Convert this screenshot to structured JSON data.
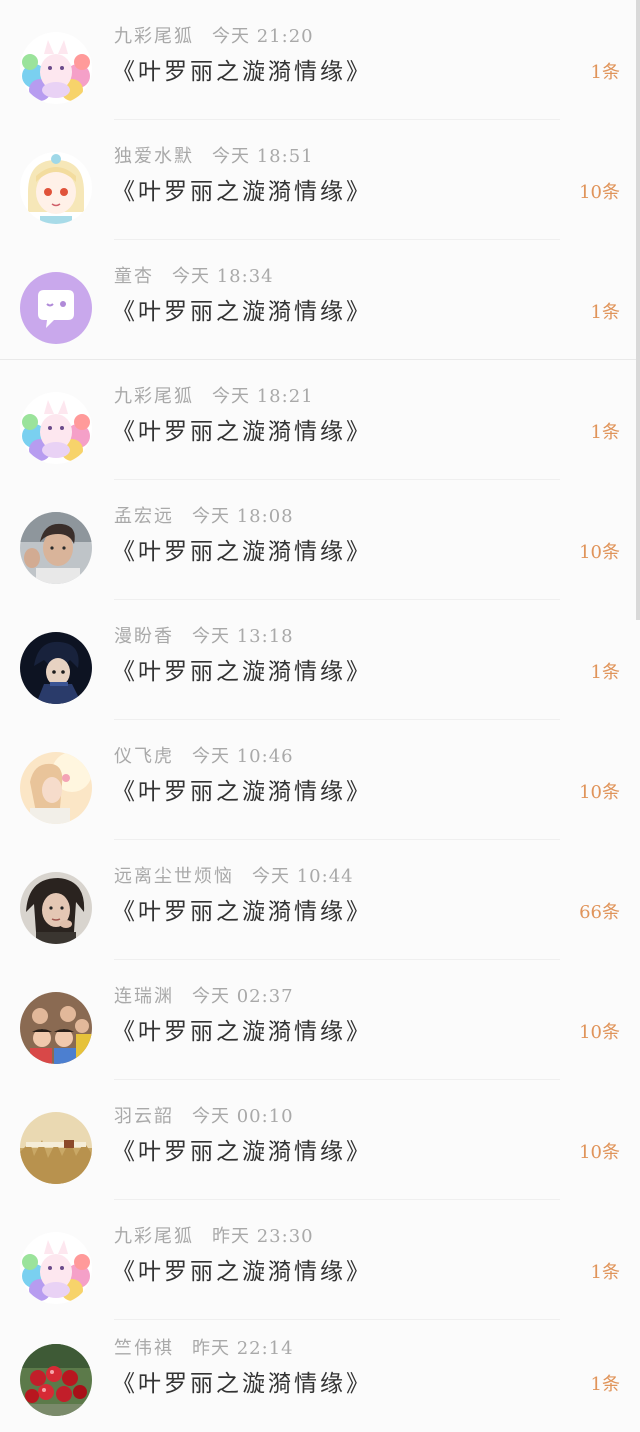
{
  "feed": {
    "accent_color": "#e0945a",
    "items": [
      {
        "user": "九彩尾狐",
        "time": "今天 21:20",
        "title": "《叶罗丽之漩漪情缘》",
        "count": "1条",
        "avatar_icon": "fox-avatar-icon"
      },
      {
        "user": "独爱水默",
        "time": "今天 18:51",
        "title": "《叶罗丽之漩漪情缘》",
        "count": "10条",
        "avatar_icon": "anime-girl-avatar-icon"
      },
      {
        "user": "童杏",
        "time": "今天 18:34",
        "title": "《叶罗丽之漩漪情缘》",
        "count": "1条",
        "avatar_icon": "chat-bubble-avatar-icon"
      },
      {
        "user": "九彩尾狐",
        "time": "今天 18:21",
        "title": "《叶罗丽之漩漪情缘》",
        "count": "1条",
        "avatar_icon": "fox-avatar-icon"
      },
      {
        "user": "孟宏远",
        "time": "今天 18:08",
        "title": "《叶罗丽之漩漪情缘》",
        "count": "10条",
        "avatar_icon": "person-photo-avatar-icon"
      },
      {
        "user": "漫盼香",
        "time": "今天 13:18",
        "title": "《叶罗丽之漩漪情缘》",
        "count": "1条",
        "avatar_icon": "ninja-avatar-icon"
      },
      {
        "user": "仪飞虎",
        "time": "今天 10:46",
        "title": "《叶罗丽之漩漪情缘》",
        "count": "10条",
        "avatar_icon": "sunlight-girl-avatar-icon"
      },
      {
        "user": "远离尘世烦恼",
        "time": "今天 10:44",
        "title": "《叶罗丽之漩漪情缘》",
        "count": "66条",
        "avatar_icon": "portrait-avatar-icon"
      },
      {
        "user": "连瑞渊",
        "time": "今天 02:37",
        "title": "《叶罗丽之漩漪情缘》",
        "count": "10条",
        "avatar_icon": "kids-group-avatar-icon"
      },
      {
        "user": "羽云韶",
        "time": "今天 00:10",
        "title": "《叶罗丽之漩漪情缘》",
        "count": "10条",
        "avatar_icon": "golden-field-avatar-icon"
      },
      {
        "user": "九彩尾狐",
        "time": "昨天 23:30",
        "title": "《叶罗丽之漩漪情缘》",
        "count": "1条",
        "avatar_icon": "fox-avatar-icon"
      },
      {
        "user": "竺伟祺",
        "time": "昨天 22:14",
        "title": "《叶罗丽之漩漪情缘》",
        "count": "1条",
        "avatar_icon": "cherries-avatar-icon"
      }
    ]
  }
}
